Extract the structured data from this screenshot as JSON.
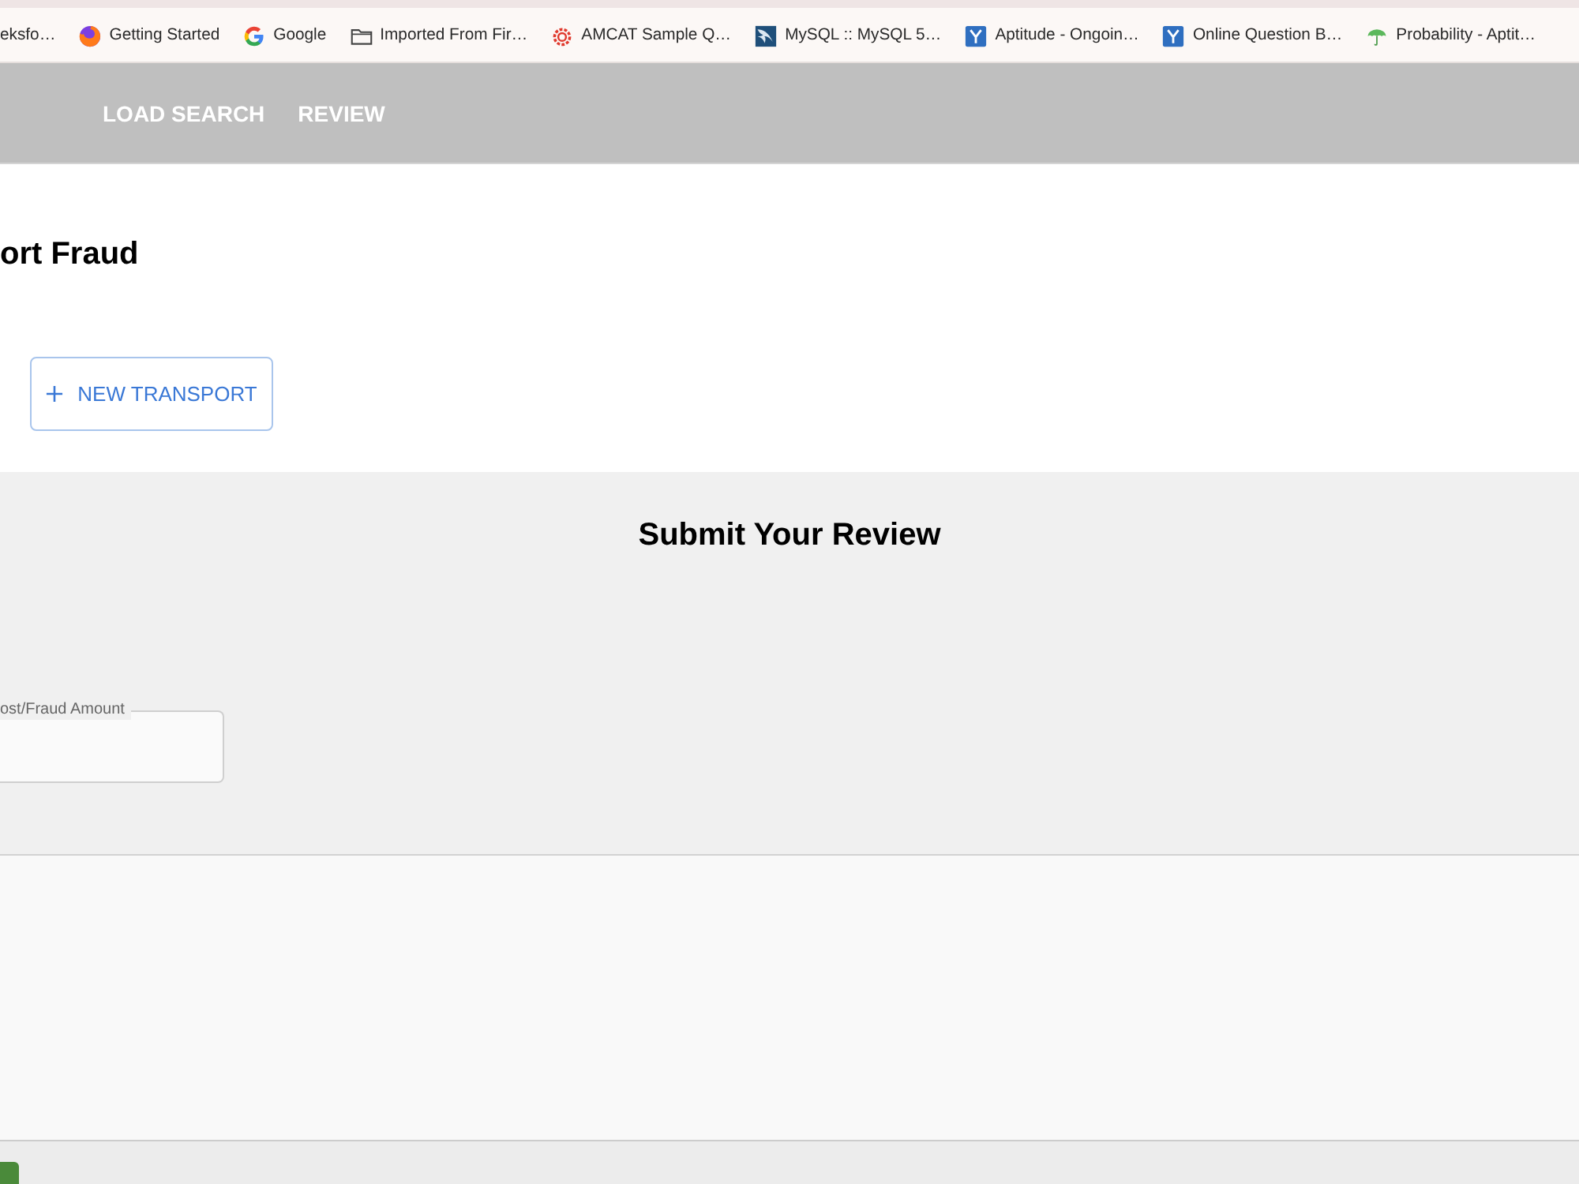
{
  "bookmarks": [
    {
      "kind": "plain",
      "label": "eksfo…"
    },
    {
      "kind": "browser",
      "label": "Getting Started"
    },
    {
      "kind": "google",
      "label": "Google"
    },
    {
      "kind": "folder",
      "label": "Imported From Fir…"
    },
    {
      "kind": "gear",
      "label": "AMCAT Sample Q…"
    },
    {
      "kind": "dolphin",
      "label": "MySQL :: MySQL 5…"
    },
    {
      "kind": "yletter",
      "label": "Aptitude - Ongoin…"
    },
    {
      "kind": "yletter",
      "label": "Online Question B…"
    },
    {
      "kind": "umbrella",
      "label": "Probability - Aptit…"
    }
  ],
  "nav": {
    "items": [
      {
        "label": "LOAD SEARCH"
      },
      {
        "label": "REVIEW"
      }
    ]
  },
  "header": {
    "title": "ort Fraud",
    "new_button": {
      "label": "NEW TRANSPORT"
    }
  },
  "review": {
    "title": "Submit Your Review",
    "amount_field": {
      "label": "ost/Fraud Amount"
    }
  }
}
